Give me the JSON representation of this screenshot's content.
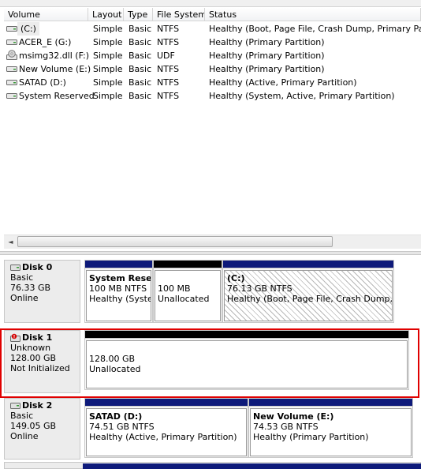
{
  "columns": [
    "Volume",
    "Layout",
    "Type",
    "File System",
    "Status"
  ],
  "volumes": [
    {
      "name": "(C:)",
      "layout": "Simple",
      "type": "Basic",
      "fs": "NTFS",
      "status": "Healthy (Boot, Page File, Crash Dump, Primary Partition)",
      "icon": "drive-icon"
    },
    {
      "name": "ACER_E (G:)",
      "layout": "Simple",
      "type": "Basic",
      "fs": "NTFS",
      "status": "Healthy (Primary Partition)",
      "icon": "drive-icon"
    },
    {
      "name": "msimg32.dll (F:)",
      "layout": "Simple",
      "type": "Basic",
      "fs": "UDF",
      "status": "Healthy (Primary Partition)",
      "icon": "cd-drive-icon"
    },
    {
      "name": "New Volume (E:)",
      "layout": "Simple",
      "type": "Basic",
      "fs": "NTFS",
      "status": "Healthy (Primary Partition)",
      "icon": "drive-icon"
    },
    {
      "name": "SATAD (D:)",
      "layout": "Simple",
      "type": "Basic",
      "fs": "NTFS",
      "status": "Healthy (Active, Primary Partition)",
      "icon": "drive-icon"
    },
    {
      "name": "System Reserved",
      "layout": "Simple",
      "type": "Basic",
      "fs": "NTFS",
      "status": "Healthy (System, Active, Primary Partition)",
      "icon": "drive-icon"
    }
  ],
  "scroll_left_glyph": "◄",
  "disks": [
    {
      "title": "Disk 0",
      "kind": "Basic",
      "size": "76.33 GB",
      "state": "Online",
      "icon": "disk-icon",
      "partitions": [
        {
          "name": "System Rese",
          "size": "100 MB NTFS",
          "status": "Healthy (Syster",
          "bar": "blue"
        },
        {
          "name": "",
          "size": "100 MB",
          "status": "Unallocated",
          "bar": "black"
        },
        {
          "name": "(C:)",
          "size": "76.13 GB NTFS",
          "status": "Healthy (Boot, Page File, Crash Dump, Prir",
          "bar": "blue",
          "hatched": true
        }
      ]
    },
    {
      "title": "Disk 1",
      "kind": "Unknown",
      "size": "128.00 GB",
      "state": "Not Initialized",
      "icon": "disk-error-icon",
      "partitions": [
        {
          "name": "",
          "size": "128.00 GB",
          "status": "Unallocated",
          "bar": "black"
        }
      ]
    },
    {
      "title": "Disk 2",
      "kind": "Basic",
      "size": "149.05 GB",
      "state": "Online",
      "icon": "disk-icon",
      "partitions": [
        {
          "name": "SATAD  (D:)",
          "size": "74.51 GB NTFS",
          "status": "Healthy (Active, Primary Partition)",
          "bar": "blue"
        },
        {
          "name": "New Volume  (E:)",
          "size": "74.53 GB NTFS",
          "status": "Healthy (Primary Partition)",
          "bar": "blue"
        }
      ]
    }
  ],
  "colors": {
    "primary_bar": "#0e1a7a",
    "unallocated_bar": "#000000",
    "highlight": "#e00000"
  }
}
